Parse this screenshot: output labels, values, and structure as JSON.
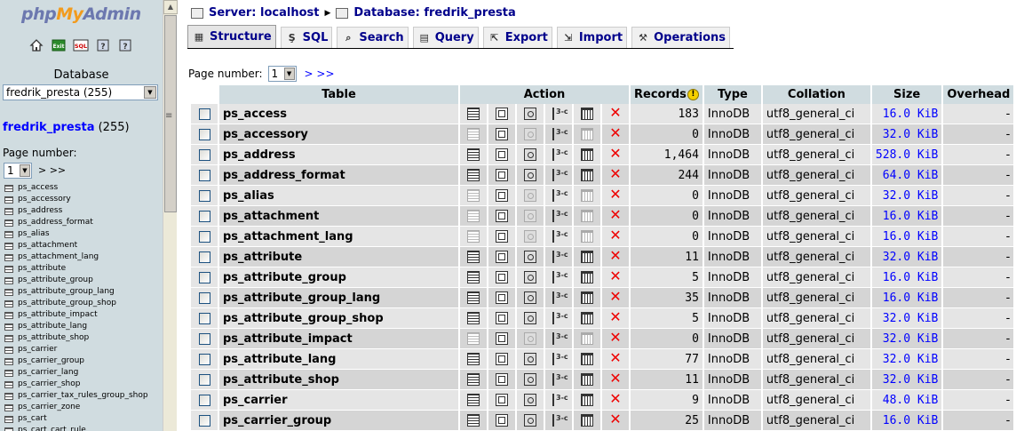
{
  "left": {
    "logo": {
      "php": "php",
      "my": "My",
      "admin": "Admin"
    },
    "quick_icons": [
      "home-icon",
      "exit-icon",
      "sql-icon",
      "docs-icon",
      "help-icon"
    ],
    "database_label": "Database",
    "database_selected": "fredrik_presta (255)",
    "db_link": {
      "name": "fredrik_presta",
      "count": "(255)"
    },
    "page_label": "Page number:",
    "page_value": "1",
    "page_next": "> >>",
    "tables": [
      "ps_access",
      "ps_accessory",
      "ps_address",
      "ps_address_format",
      "ps_alias",
      "ps_attachment",
      "ps_attachment_lang",
      "ps_attribute",
      "ps_attribute_group",
      "ps_attribute_group_lang",
      "ps_attribute_group_shop",
      "ps_attribute_impact",
      "ps_attribute_lang",
      "ps_attribute_shop",
      "ps_carrier",
      "ps_carrier_group",
      "ps_carrier_lang",
      "ps_carrier_shop",
      "ps_carrier_tax_rules_group_shop",
      "ps_carrier_zone",
      "ps_cart",
      "ps_cart_cart_rule"
    ]
  },
  "breadcrumb": {
    "server": "Server: localhost",
    "database": "Database: fredrik_presta"
  },
  "tabs": [
    {
      "icon": "structure-icon",
      "label": "Structure",
      "active": true
    },
    {
      "icon": "sql-icon",
      "label": "SQL",
      "active": false
    },
    {
      "icon": "search-icon",
      "label": "Search",
      "active": false
    },
    {
      "icon": "query-icon",
      "label": "Query",
      "active": false
    },
    {
      "icon": "export-icon",
      "label": "Export",
      "active": false
    },
    {
      "icon": "import-icon",
      "label": "Import",
      "active": false
    },
    {
      "icon": "operations-icon",
      "label": "Operations",
      "active": false
    }
  ],
  "page": {
    "label": "Page number:",
    "value": "1",
    "next": "> >>"
  },
  "table": {
    "headers": {
      "table": "Table",
      "action": "Action",
      "records": "Records",
      "type": "Type",
      "collation": "Collation",
      "size": "Size",
      "overhead": "Overhead"
    },
    "rows": [
      {
        "name": "ps_access",
        "records": "183",
        "type": "InnoDB",
        "collation": "utf8_general_ci",
        "size": "16.0 KiB",
        "overhead": "-",
        "empty": false
      },
      {
        "name": "ps_accessory",
        "records": "0",
        "type": "InnoDB",
        "collation": "utf8_general_ci",
        "size": "32.0 KiB",
        "overhead": "-",
        "empty": true
      },
      {
        "name": "ps_address",
        "records": "1,464",
        "type": "InnoDB",
        "collation": "utf8_general_ci",
        "size": "528.0 KiB",
        "overhead": "-",
        "empty": false
      },
      {
        "name": "ps_address_format",
        "records": "244",
        "type": "InnoDB",
        "collation": "utf8_general_ci",
        "size": "64.0 KiB",
        "overhead": "-",
        "empty": false
      },
      {
        "name": "ps_alias",
        "records": "0",
        "type": "InnoDB",
        "collation": "utf8_general_ci",
        "size": "32.0 KiB",
        "overhead": "-",
        "empty": true
      },
      {
        "name": "ps_attachment",
        "records": "0",
        "type": "InnoDB",
        "collation": "utf8_general_ci",
        "size": "16.0 KiB",
        "overhead": "-",
        "empty": true
      },
      {
        "name": "ps_attachment_lang",
        "records": "0",
        "type": "InnoDB",
        "collation": "utf8_general_ci",
        "size": "16.0 KiB",
        "overhead": "-",
        "empty": true
      },
      {
        "name": "ps_attribute",
        "records": "11",
        "type": "InnoDB",
        "collation": "utf8_general_ci",
        "size": "32.0 KiB",
        "overhead": "-",
        "empty": false
      },
      {
        "name": "ps_attribute_group",
        "records": "5",
        "type": "InnoDB",
        "collation": "utf8_general_ci",
        "size": "16.0 KiB",
        "overhead": "-",
        "empty": false
      },
      {
        "name": "ps_attribute_group_lang",
        "records": "35",
        "type": "InnoDB",
        "collation": "utf8_general_ci",
        "size": "16.0 KiB",
        "overhead": "-",
        "empty": false
      },
      {
        "name": "ps_attribute_group_shop",
        "records": "5",
        "type": "InnoDB",
        "collation": "utf8_general_ci",
        "size": "32.0 KiB",
        "overhead": "-",
        "empty": false
      },
      {
        "name": "ps_attribute_impact",
        "records": "0",
        "type": "InnoDB",
        "collation": "utf8_general_ci",
        "size": "32.0 KiB",
        "overhead": "-",
        "empty": true
      },
      {
        "name": "ps_attribute_lang",
        "records": "77",
        "type": "InnoDB",
        "collation": "utf8_general_ci",
        "size": "32.0 KiB",
        "overhead": "-",
        "empty": false
      },
      {
        "name": "ps_attribute_shop",
        "records": "11",
        "type": "InnoDB",
        "collation": "utf8_general_ci",
        "size": "32.0 KiB",
        "overhead": "-",
        "empty": false
      },
      {
        "name": "ps_carrier",
        "records": "9",
        "type": "InnoDB",
        "collation": "utf8_general_ci",
        "size": "48.0 KiB",
        "overhead": "-",
        "empty": false
      },
      {
        "name": "ps_carrier_group",
        "records": "25",
        "type": "InnoDB",
        "collation": "utf8_general_ci",
        "size": "16.0 KiB",
        "overhead": "-",
        "empty": false
      }
    ]
  }
}
